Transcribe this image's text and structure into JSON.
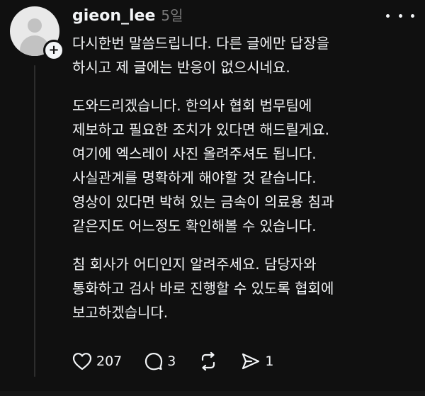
{
  "post": {
    "username": "gieon_lee",
    "timestamp": "5일",
    "paragraphs": [
      {
        "lines": [
          "다시한번 말씀드립니다. 다른 글에만 답장을",
          "하시고 제 글에는 반응이 없으시네요."
        ]
      },
      {
        "lines": [
          "도와드리겠습니다. 한의사 협회 법무팀에",
          "제보하고 필요한 조치가 있다면 해드릴게요.",
          "여기에 엑스레이 사진 올려주셔도 됩니다.",
          "사실관계를 명확하게 해야할 것 같습니다.",
          "영상이 있다면 박혀 있는 금속이 의료용 침과",
          "같은지도 어느정도 확인해볼 수 있습니다."
        ]
      },
      {
        "lines": [
          "침 회사가 어디인지 알려주세요. 담당자와",
          "통화하고 검사 바로 진행할 수 있도록 협회에",
          "보고하겠습니다."
        ]
      }
    ]
  },
  "actions": {
    "likes": "207",
    "replies": "3",
    "shares": "1"
  },
  "icons": {
    "avatar": "default-avatar-icon",
    "follow": "plus-icon",
    "more": "more-options-icon",
    "like": "heart-icon",
    "reply": "comment-icon",
    "repost": "repost-icon",
    "share": "send-icon"
  },
  "colors": {
    "background": "#101010",
    "text": "#f3f5f7",
    "secondary": "#777777"
  }
}
